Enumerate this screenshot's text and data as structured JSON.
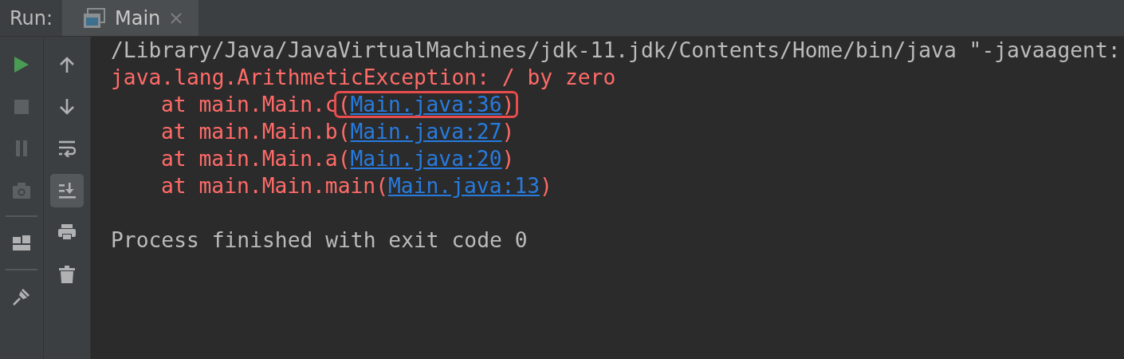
{
  "run_bar": {
    "label": "Run:",
    "tabs": [
      {
        "label": "Main",
        "selected": true
      }
    ]
  },
  "toolbar": {
    "left": [
      {
        "kind": "run",
        "disabled": false
      },
      {
        "kind": "stop",
        "disabled": true
      },
      {
        "kind": "pause",
        "disabled": true
      },
      {
        "kind": "camera",
        "disabled": true
      },
      {
        "kind": "divider"
      },
      {
        "kind": "layout",
        "disabled": false
      },
      {
        "kind": "divider"
      },
      {
        "kind": "pin",
        "disabled": false
      }
    ],
    "right": [
      {
        "kind": "up",
        "selected": false
      },
      {
        "kind": "down",
        "selected": false
      },
      {
        "kind": "wrap",
        "selected": false
      },
      {
        "kind": "scroll-end",
        "selected": true
      },
      {
        "kind": "print",
        "selected": false
      },
      {
        "kind": "trash",
        "selected": false
      }
    ]
  },
  "console": {
    "command": "/Library/Java/JavaVirtualMachines/jdk-11.jdk/Contents/Home/bin/java \"-javaagent:",
    "exception": "java.lang.ArithmeticException: / by zero",
    "frames": [
      {
        "prefix": "at main.Main.c(",
        "link": "Main.java:36",
        "suffix": ")",
        "highlighted": true
      },
      {
        "prefix": "at main.Main.b(",
        "link": "Main.java:27",
        "suffix": ")",
        "highlighted": false
      },
      {
        "prefix": "at main.Main.a(",
        "link": "Main.java:20",
        "suffix": ")",
        "highlighted": false
      },
      {
        "prefix": "at main.Main.main(",
        "link": "Main.java:13",
        "suffix": ")",
        "highlighted": false
      }
    ],
    "exit_message": "Process finished with exit code 0"
  }
}
